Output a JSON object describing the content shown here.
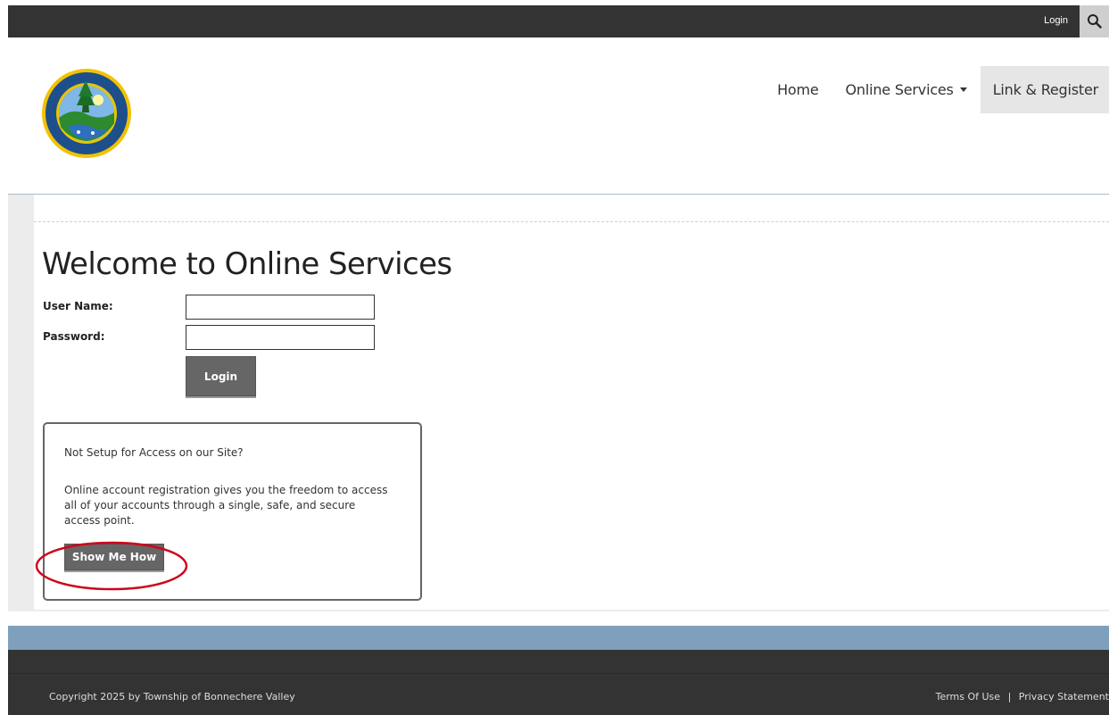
{
  "topbar": {
    "login_label": "Login",
    "search_icon": "search-icon"
  },
  "header": {
    "logo_icon": "township-seal-logo",
    "nav": {
      "home": "Home",
      "online_services": "Online Services",
      "link_register": "Link & Register"
    }
  },
  "main": {
    "title": "Welcome to Online Services",
    "username_label": "User Name:",
    "username_value": "",
    "password_label": "Password:",
    "password_value": "",
    "login_button": "Login",
    "registration": {
      "question": "Not Setup for Access on our Site?",
      "description": "Online account registration gives you the freedom to access all of your accounts through a single, safe, and secure access point.",
      "button": "Show Me How"
    }
  },
  "footer": {
    "copyright": "Copyright 2025 by Township of Bonnechere Valley",
    "terms": "Terms Of Use",
    "separator": "|",
    "privacy": "Privacy Statement"
  },
  "colors": {
    "topbar": "#333333",
    "blue_band": "#7fa0bd",
    "button": "#666666",
    "highlight_oval": "#d0021b"
  }
}
